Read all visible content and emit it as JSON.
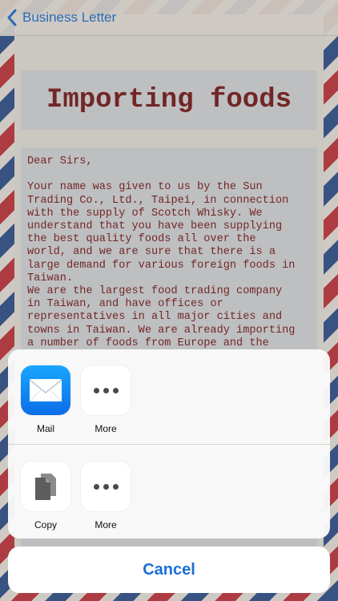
{
  "nav": {
    "back_label": "Business Letter"
  },
  "letter": {
    "title": "Importing foods",
    "body": "Dear Sirs,\n\nYour name was given to us by the Sun\nTrading Co., Ltd., Taipei, in connection\nwith the supply of Scotch Whisky. We\nunderstand that you have been supplying\nthe best quality foods all over the\nworld, and we are sure that there is a\nlarge demand for various foreign foods in\nTaiwan.\nWe are the largest food trading company\nin Taiwan, and have offices or\nrepresentatives in all major cities and\ntowns in Taiwan. We are already importing\na number of foods from Europe and the"
  },
  "share_sheet": {
    "row1": [
      {
        "label": "Mail",
        "icon": "mail-icon"
      },
      {
        "label": "More",
        "icon": "more-icon"
      }
    ],
    "row2": [
      {
        "label": "Copy",
        "icon": "copy-icon"
      },
      {
        "label": "More",
        "icon": "more-icon"
      }
    ],
    "cancel_label": "Cancel"
  },
  "colors": {
    "accent": "#1b6fd6",
    "letter_text": "#7a1416"
  }
}
